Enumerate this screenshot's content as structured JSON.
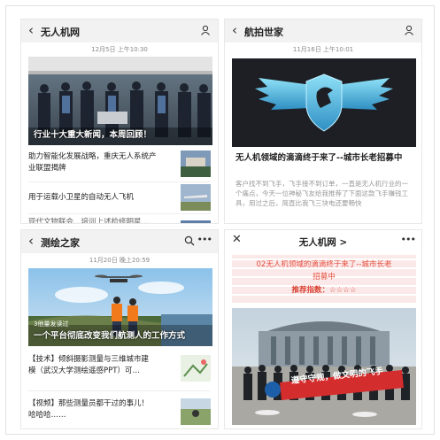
{
  "panels": {
    "top_left": {
      "title": "无人机网",
      "timestamp": "12月5日 上午10:30",
      "hero_caption": "行业十大重大新闻，本周回顾！",
      "items": [
        "助力智能化发展战略，重庆无人系统产",
        "业联盟揭牌",
        "用于运载小卫星的自动无人飞机",
        "现代文物联会…培训上述检修明星…"
      ]
    },
    "top_right": {
      "title": "航拍世家",
      "timestamp": "11月16日 上午10:01",
      "article_title": "无人机领域的滴滴终于来了--城市长老招募中",
      "article_desc": "客户找不到飞手，飞手接不到订单，一直是无人机行业的一个痛点，今天一位神秘飞友给我推荐了下面这款飞手赚钱工具，用过之后，简直比我飞三块电还要畅快"
    },
    "bottom_left": {
      "title": "测绘之家",
      "timestamp": "11月20日 晚上20:59",
      "hero_stamp": "3他量发读过",
      "hero_caption": "一个平台彻底改变我们航测人的工作方式",
      "items": [
        "【技术】倾斜摄影测量与三维城市建",
        "模（武汉大学测绘遥感PPT）可…",
        "【视频】那些测量员都干过的事儿！",
        "哈哈哈……"
      ]
    },
    "bottom_right": {
      "title": "无人机网 >",
      "promo_line1": "02无人机领域的滴滴终于来了--城市长老",
      "promo_line2": "招募中",
      "promo_rating": "推荐指数：☆☆☆☆",
      "banner_text": "遵守守规，做文明的飞手"
    }
  },
  "colors": {
    "header_bg": "#f2f2f2",
    "accent_red": "#e64c3c",
    "wing_blue": "#4cc0e6",
    "dark_card": "#1e1f24"
  },
  "icons": [
    "back-arrow-icon",
    "person-icon",
    "search-icon",
    "more-icon",
    "close-icon",
    "drone-icon",
    "eagle-logo-icon"
  ]
}
